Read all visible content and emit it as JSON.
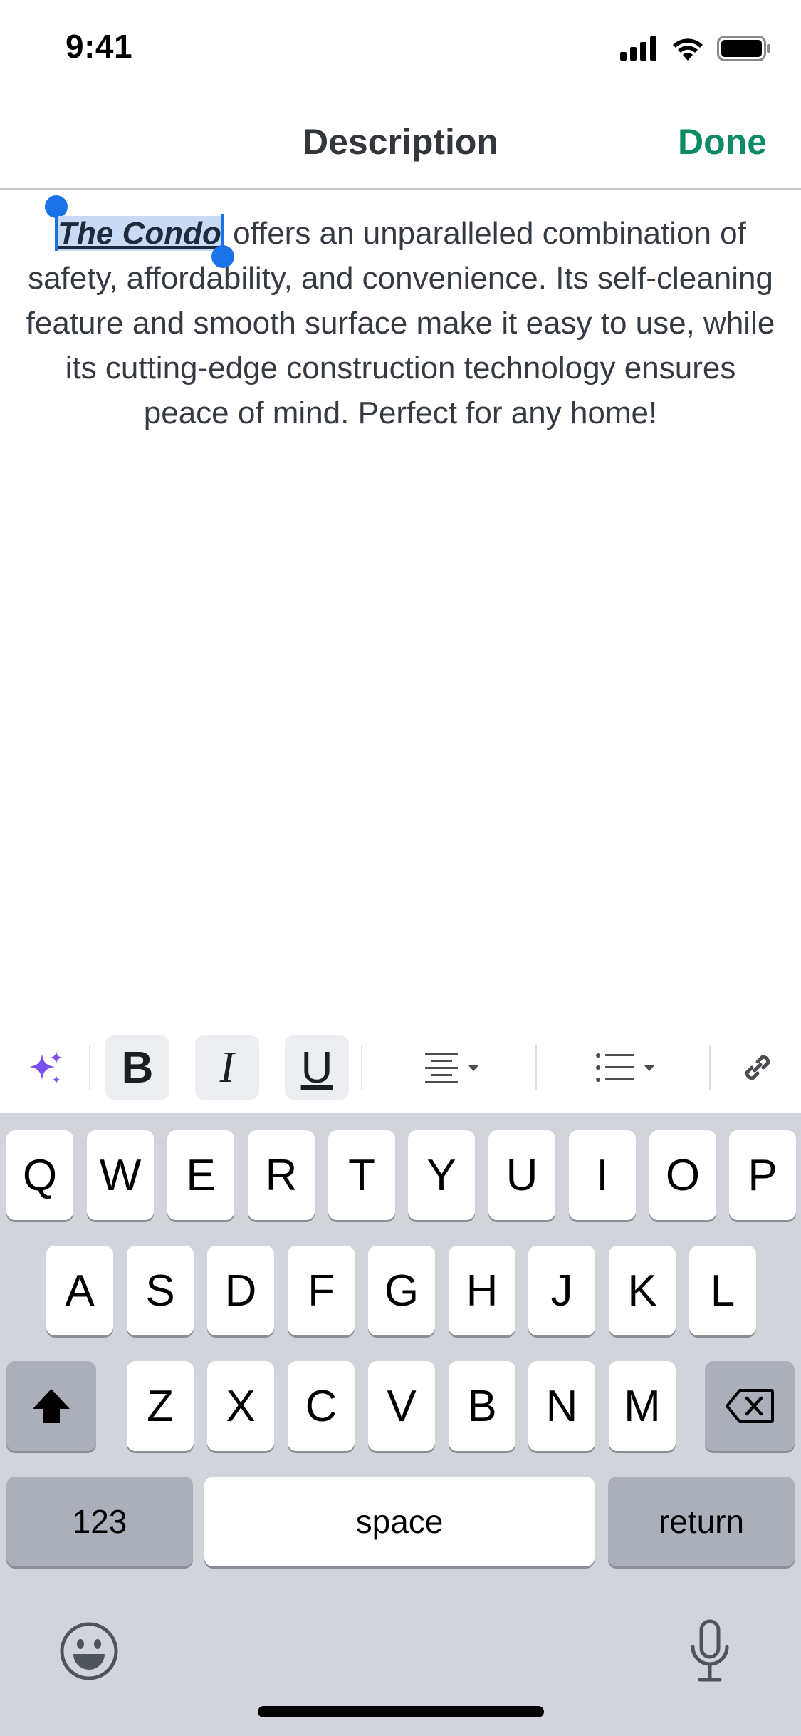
{
  "status_bar": {
    "time": "9:41",
    "icons": [
      "cellular-signal-icon",
      "wifi-icon",
      "battery-icon"
    ]
  },
  "nav": {
    "title": "Description",
    "done_label": "Done",
    "done_color": "#0d8a66"
  },
  "editor": {
    "selected_text": "The Condo",
    "body_text": " offers an unparalleled combination of safety, affordability, and convenience. Its self-cleaning feature and smooth surface make it easy to use, while its cutting-edge construction technology ensures peace of mind. Perfect for any home!",
    "selection_color": "#1a73e8",
    "selected_styles": [
      "bold",
      "italic",
      "underline"
    ]
  },
  "toolbar": {
    "ai_icon": "sparkles-icon",
    "bold_label": "B",
    "italic_label": "I",
    "underline_label": "U",
    "align_icon": "align-center-icon",
    "list_icon": "bulleted-list-icon",
    "link_icon": "link-icon",
    "active_formats": [
      "bold",
      "italic",
      "underline"
    ]
  },
  "keyboard": {
    "row1": [
      "Q",
      "W",
      "E",
      "R",
      "T",
      "Y",
      "U",
      "I",
      "O",
      "P"
    ],
    "row2": [
      "A",
      "S",
      "D",
      "F",
      "G",
      "H",
      "J",
      "K",
      "L"
    ],
    "row3": [
      "Z",
      "X",
      "C",
      "V",
      "B",
      "N",
      "M"
    ],
    "numbers_label": "123",
    "space_label": "space",
    "return_label": "return",
    "shift_icon": "shift-icon",
    "delete_icon": "backspace-icon",
    "emoji_icon": "emoji-icon",
    "mic_icon": "microphone-icon"
  }
}
